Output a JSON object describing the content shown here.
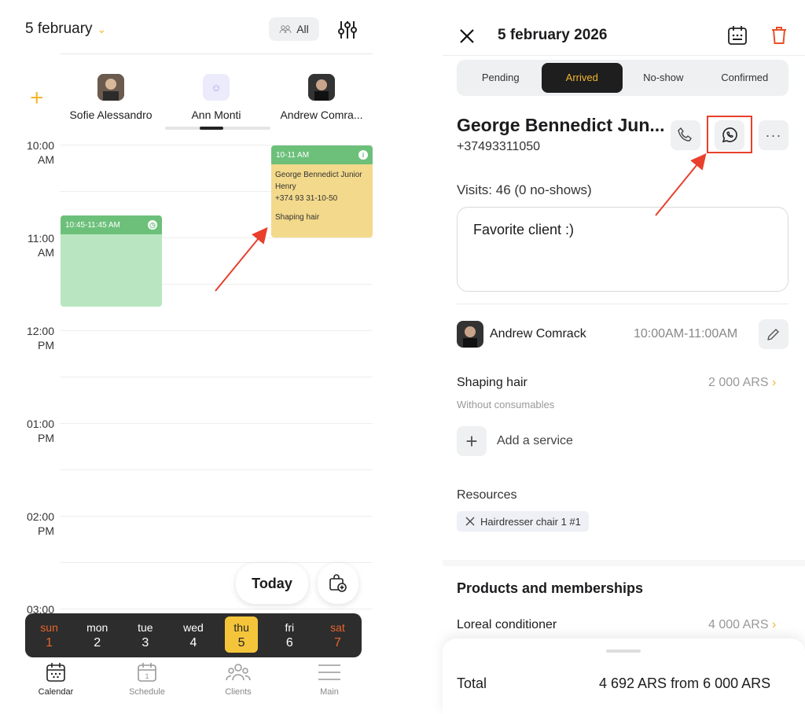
{
  "left": {
    "header": {
      "date": "5 february",
      "all_label": "All"
    },
    "staff": [
      {
        "name": "Sofie Alessandro"
      },
      {
        "name": "Ann Monti"
      },
      {
        "name": "Andrew Comra..."
      }
    ],
    "time_labels": [
      {
        "h": "10:00",
        "p": "AM"
      },
      {
        "h": "11:00",
        "p": "AM"
      },
      {
        "h": "12:00",
        "p": "PM"
      },
      {
        "h": "01:00",
        "p": "PM"
      },
      {
        "h": "02:00",
        "p": "PM"
      },
      {
        "h": "03:00",
        "p": ""
      }
    ],
    "events": {
      "green": {
        "time": "10:45-11:45 AM",
        "color": "#6cc07a",
        "body_color": "#b9e6c1"
      },
      "yellow": {
        "time": "10-11 AM",
        "client": "George Bennedict Junior Henry",
        "phone": "+374 93 31-10-50",
        "service": "Shaping hair",
        "head_color": "#6cc07a",
        "body_color": "#f3d98b"
      }
    },
    "today_label": "Today",
    "week": [
      {
        "d": "sun",
        "n": "1"
      },
      {
        "d": "mon",
        "n": "2"
      },
      {
        "d": "tue",
        "n": "3"
      },
      {
        "d": "wed",
        "n": "4"
      },
      {
        "d": "thu",
        "n": "5"
      },
      {
        "d": "fri",
        "n": "6"
      },
      {
        "d": "sat",
        "n": "7"
      }
    ],
    "tabs": [
      {
        "label": "Calendar"
      },
      {
        "label": "Schedule"
      },
      {
        "label": "Clients"
      },
      {
        "label": "Main"
      }
    ],
    "accent": "#f4b630"
  },
  "right": {
    "title": "5 february 2026",
    "status_tabs": [
      "Pending",
      "Arrived",
      "No-show",
      "Confirmed"
    ],
    "client": {
      "name": "George Bennedict Jun...",
      "phone": "+37493311050",
      "visits": "Visits: 46 (0 no-shows)",
      "note": "Favorite client :)"
    },
    "staff": {
      "name": "Andrew Comrack",
      "time": "10:00AM-11:00AM"
    },
    "service": {
      "name": "Shaping hair",
      "sub": "Without consumables",
      "price": "2 000 ARS"
    },
    "add_service": "Add a service",
    "resources": {
      "title": "Resources",
      "chip": "Hairdresser chair 1 #1"
    },
    "products": {
      "title": "Products and memberships",
      "item": "Loreal conditioner",
      "price": "4 000 ARS"
    },
    "total": {
      "label": "Total",
      "value": "4 692 ARS from 6 000 ARS"
    },
    "highlight_color": "#e8402c"
  }
}
